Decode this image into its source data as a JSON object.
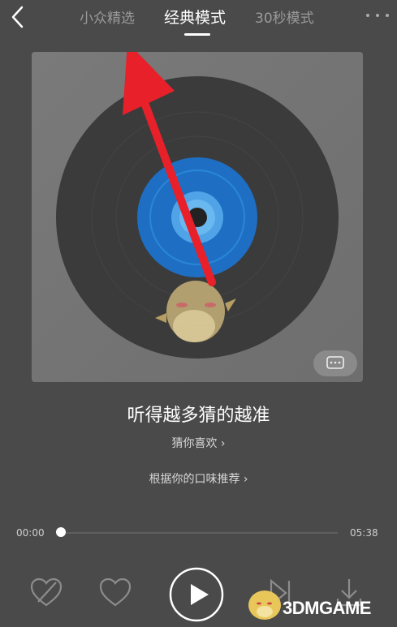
{
  "header": {
    "tabs": [
      {
        "label": "小众精选",
        "active": false
      },
      {
        "label": "经典模式",
        "active": true
      },
      {
        "label": "30秒模式",
        "active": false
      }
    ],
    "back_icon": "chevron-left-icon",
    "more_icon": "more-dots-icon"
  },
  "song": {
    "title": "听得越多猜的越准",
    "subtitle": "猜你喜欢 ›",
    "recommend": "根据你的口味推荐 ›"
  },
  "player": {
    "current_time": "00:00",
    "total_time": "05:38",
    "progress": 0.0
  },
  "controls": [
    "dislike-heart-icon",
    "like-heart-icon",
    "play-icon",
    "next-icon",
    "download-icon"
  ],
  "watermark": {
    "text": "3DMGAME"
  },
  "colors": {
    "background": "#4a4a4a",
    "disc": "#3a3a3a",
    "label": "#1e72c8",
    "arrow": "#e8202a"
  }
}
